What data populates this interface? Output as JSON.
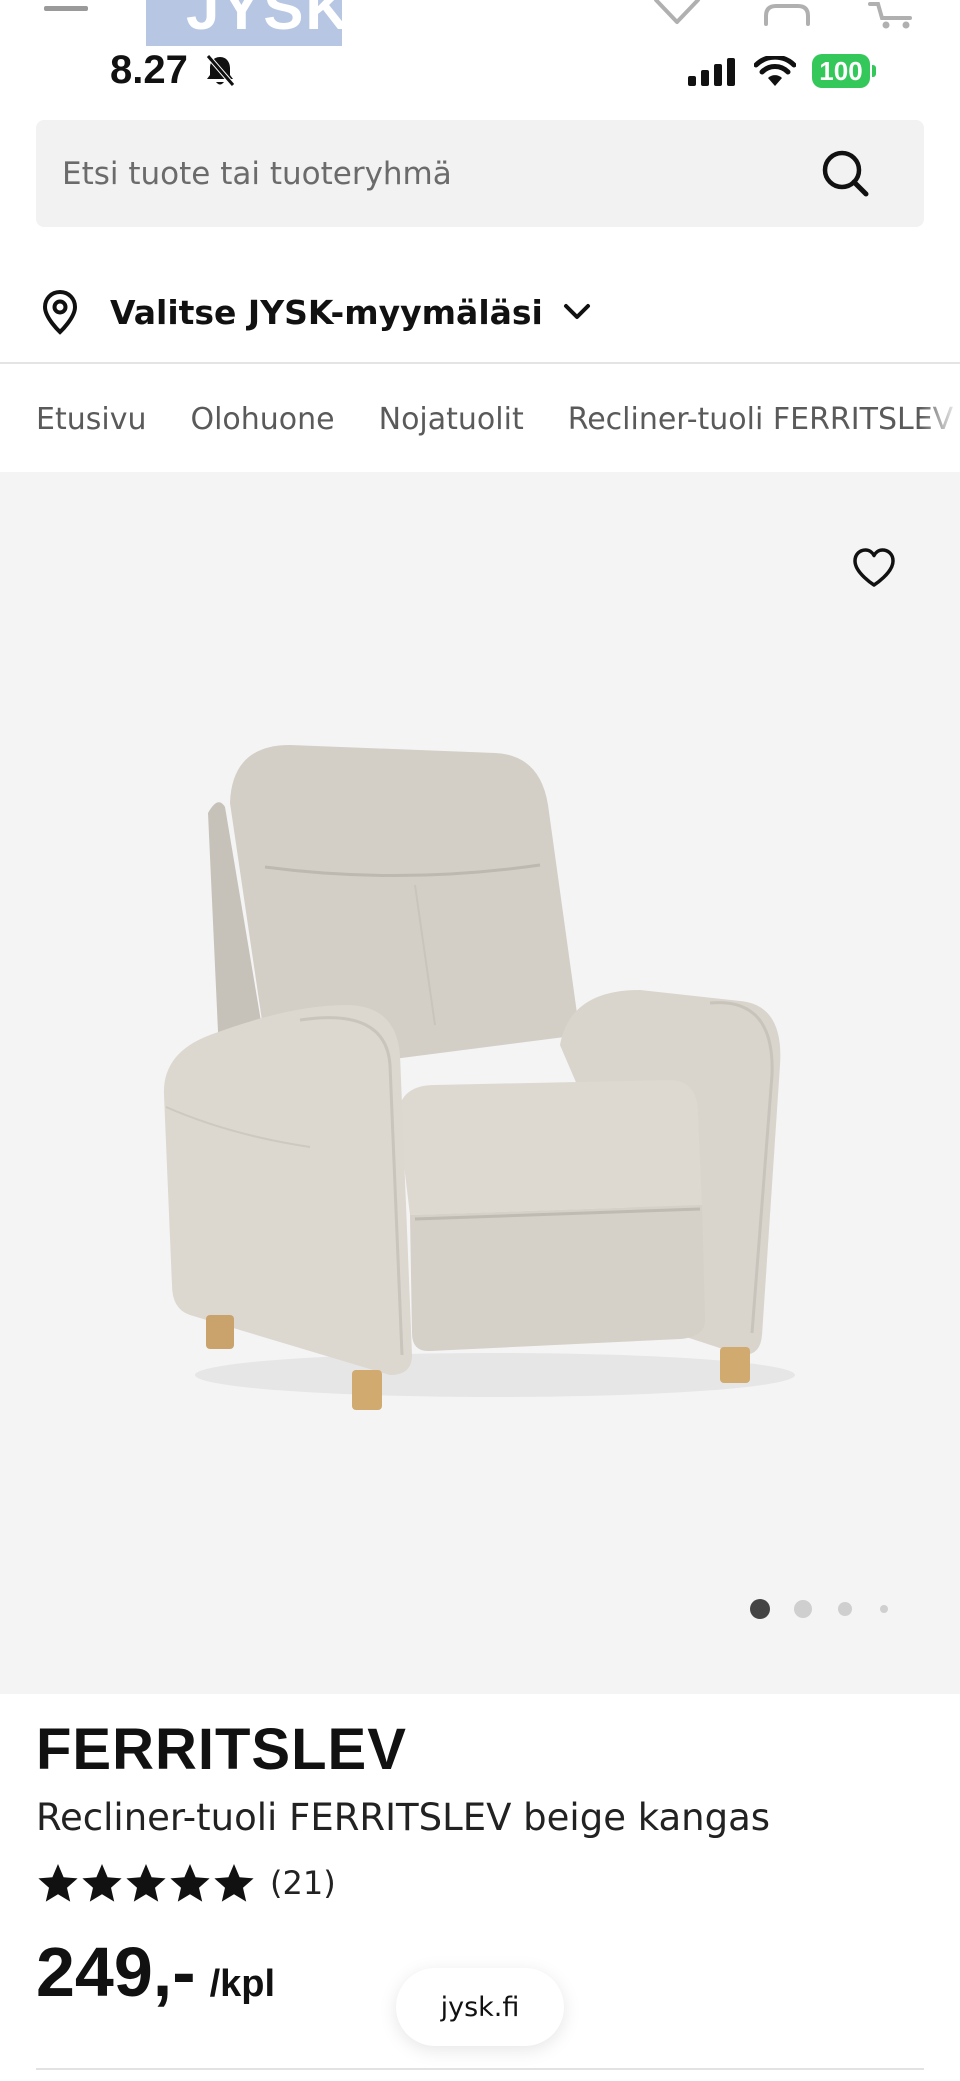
{
  "header": {
    "logo_text": "JYSK"
  },
  "status_bar": {
    "time": "8.27",
    "battery": "100"
  },
  "search": {
    "placeholder": "Etsi tuote tai tuoteryhmä"
  },
  "store_selector": {
    "label": "Valitse JYSK-myymäläsi"
  },
  "breadcrumb": {
    "items": [
      "Etusivu",
      "Olohuone",
      "Nojatuolit",
      "Recliner-tuoli FERRITSLEV b"
    ]
  },
  "gallery": {
    "image_count": 4,
    "active_index": 0
  },
  "product": {
    "brand": "FERRITSLEV",
    "name": "Recliner-tuoli FERRITSLEV beige kangas",
    "rating_stars": 5,
    "rating_count": "(21)",
    "price": "249,-",
    "price_unit": "/kpl"
  },
  "browser": {
    "url": "jysk.fi"
  },
  "colors": {
    "battery": "#34c759",
    "logo_bg": "#b7c6e2",
    "gallery_bg": "#f4f4f4",
    "upholstery": "#d9d4cc"
  }
}
